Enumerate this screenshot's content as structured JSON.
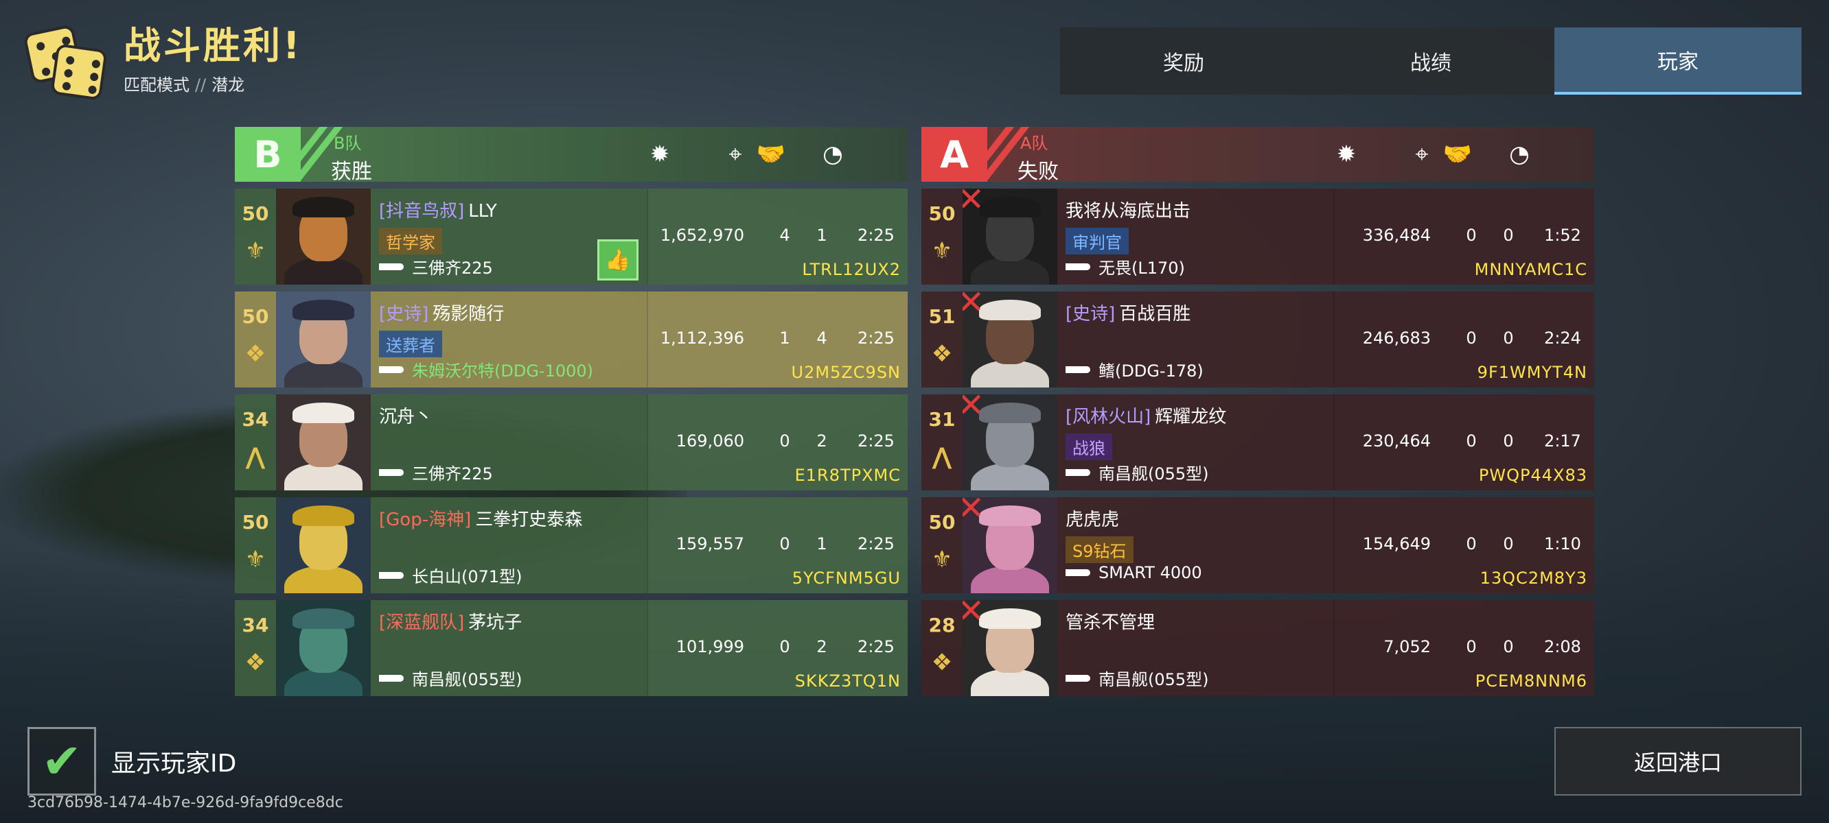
{
  "header": {
    "title": "战斗胜利!",
    "mode": "匹配模式",
    "separator": "//",
    "map": "潜龙"
  },
  "tabs": [
    {
      "label": "奖励",
      "active": false
    },
    {
      "label": "战绩",
      "active": false
    },
    {
      "label": "玩家",
      "active": true
    }
  ],
  "team_b": {
    "letter": "B",
    "label": "B队",
    "result": "获胜",
    "color": "#6fd268",
    "players": [
      {
        "level": "50",
        "tag": "[抖音鸟叔]",
        "name": "LLY",
        "badge": "哲学家",
        "ship": "三佛齐225",
        "damage": "1,652,970",
        "kills": "4",
        "assists": "1",
        "time": "2:25",
        "id": "LTRL12UX2",
        "liked": true
      },
      {
        "level": "50",
        "tag": "[史诗]",
        "name": "殇影随行",
        "badge": "送葬者",
        "ship": "朱姆沃尔特(DDG-1000)",
        "damage": "1,112,396",
        "kills": "1",
        "assists": "4",
        "time": "2:25",
        "id": "U2M5ZC9SN",
        "mvp": true
      },
      {
        "level": "34",
        "tag": "",
        "name": "沉舟丶",
        "badge": "",
        "ship": "三佛齐225",
        "damage": "169,060",
        "kills": "0",
        "assists": "2",
        "time": "2:25",
        "id": "E1R8TPXMC"
      },
      {
        "level": "50",
        "tag": "[Gop-海神]",
        "name": "三拳打史泰森",
        "badge": "",
        "ship": "长白山(071型)",
        "damage": "159,557",
        "kills": "0",
        "assists": "1",
        "time": "2:25",
        "id": "5YCFNM5GU"
      },
      {
        "level": "34",
        "tag": "[深蓝舰队]",
        "name": "茅坑子",
        "badge": "",
        "ship": "南昌舰(055型)",
        "damage": "101,999",
        "kills": "0",
        "assists": "2",
        "time": "2:25",
        "id": "SKKZ3TQ1N"
      }
    ]
  },
  "team_a": {
    "letter": "A",
    "label": "A队",
    "result": "失败",
    "color": "#e24444",
    "players": [
      {
        "level": "50",
        "tag": "",
        "name": "我将从海底出击",
        "badge": "审判官",
        "ship": "无畏(L170)",
        "damage": "336,484",
        "kills": "0",
        "assists": "0",
        "time": "1:52",
        "id": "MNNYAMC1C"
      },
      {
        "level": "51",
        "tag": "[史诗]",
        "name": "百战百胜",
        "badge": "",
        "ship": "鳍(DDG-178)",
        "damage": "246,683",
        "kills": "0",
        "assists": "0",
        "time": "2:24",
        "id": "9F1WMYT4N"
      },
      {
        "level": "31",
        "tag": "[风林火山]",
        "name": "辉耀龙纹",
        "badge": "战狼",
        "ship": "南昌舰(055型)",
        "damage": "230,464",
        "kills": "0",
        "assists": "0",
        "time": "2:17",
        "id": "PWQP44X83"
      },
      {
        "level": "50",
        "tag": "",
        "name": "虎虎虎",
        "badge": "S9钻石",
        "ship": "SMART 4000",
        "damage": "154,649",
        "kills": "0",
        "assists": "0",
        "time": "1:10",
        "id": "13QC2M8Y3"
      },
      {
        "level": "28",
        "tag": "",
        "name": "管杀不管埋",
        "badge": "",
        "ship": "南昌舰(055型)",
        "damage": "7,052",
        "kills": "0",
        "assists": "0",
        "time": "2:08",
        "id": "PCEM8NNM6"
      }
    ]
  },
  "footer": {
    "show_id_label": "显示玩家ID",
    "show_id_checked": true,
    "uuid": "3cd76b98-1474-4b7e-926d-9fa9fd9ce8dc",
    "return_label": "返回港口"
  },
  "icons": [
    "dice-logo-icon",
    "damage-icon",
    "kill-icon",
    "assist-icon",
    "time-icon",
    "rank-icon",
    "ship-icon",
    "like-icon",
    "check-icon",
    "defeated-x-icon"
  ]
}
